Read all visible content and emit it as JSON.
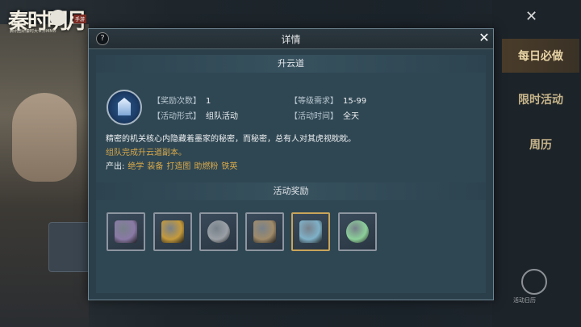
{
  "game": {
    "logo_text": "秦时明月",
    "logo_mark": "手游",
    "logo_subtitle": "腾讯自研秦时大世界MMO"
  },
  "side_panel": {
    "close_icon": "close-icon",
    "tabs": [
      "每日必做",
      "限时活动",
      "周历"
    ],
    "active_tab": 0,
    "bottom_label": "活动日历"
  },
  "dialog": {
    "help_label": "?",
    "title": "详情",
    "close_label": "✕",
    "activity_name": "升云道",
    "fields": {
      "reward_count": {
        "key": "【奖励次数】",
        "value": "1"
      },
      "level_req": {
        "key": "【等级需求】",
        "value": "15-99"
      },
      "form": {
        "key": "【活动形式】",
        "value": "组队活动"
      },
      "time": {
        "key": "【活动时间】",
        "value": "全天"
      }
    },
    "description": "精密的机关核心内隐藏着墨家的秘密，而秘密，总有人对其虎视眈眈。",
    "hint": "组队完成升云道副本。",
    "produce_label": "产出:",
    "produce_items": [
      "绝学",
      "装备",
      "打造图",
      "助燃粉",
      "铁英"
    ],
    "rewards_header": "活动奖励",
    "rewards": [
      {
        "name": "armor-icon",
        "color": "#8a7aa6",
        "border": "#8d95a0"
      },
      {
        "name": "gold-ore-icon",
        "color": "#c49a3c",
        "border": "#8d95a0"
      },
      {
        "name": "stone-tablet-icon",
        "color": "#9aa0a6",
        "border": "#8d95a0"
      },
      {
        "name": "scroll-icon",
        "color": "#a08b6a",
        "border": "#8d95a0"
      },
      {
        "name": "crystal-ore-icon",
        "color": "#7fb1c8",
        "border": "#c9a55a"
      },
      {
        "name": "jade-disc-icon",
        "color": "#8ccf9a",
        "border": "#8d95a0"
      }
    ]
  }
}
